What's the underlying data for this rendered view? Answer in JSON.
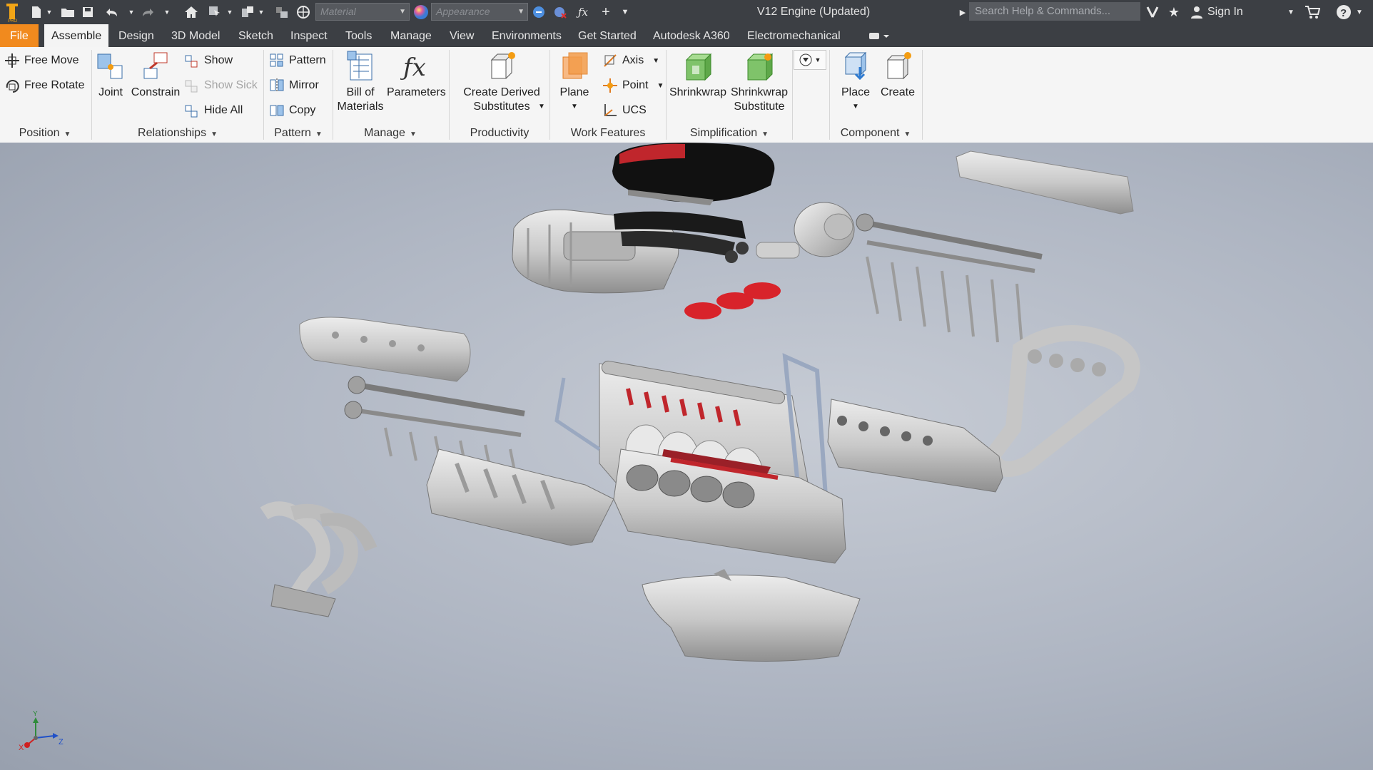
{
  "titlebar": {
    "material_placeholder": "Material",
    "appearance_placeholder": "Appearance",
    "document_title": "V12 Engine (Updated)",
    "search_placeholder": "Search Help & Commands...",
    "sign_in": "Sign In"
  },
  "tabs": [
    {
      "label": "File"
    },
    {
      "label": "Assemble"
    },
    {
      "label": "Design"
    },
    {
      "label": "3D Model"
    },
    {
      "label": "Sketch"
    },
    {
      "label": "Inspect"
    },
    {
      "label": "Tools"
    },
    {
      "label": "Manage"
    },
    {
      "label": "View"
    },
    {
      "label": "Environments"
    },
    {
      "label": "Get Started"
    },
    {
      "label": "Autodesk A360"
    },
    {
      "label": "Electromechanical"
    }
  ],
  "ribbon": {
    "position": {
      "free_move": "Free Move",
      "free_rotate": "Free Rotate",
      "group": "Position"
    },
    "relationships": {
      "joint": "Joint",
      "constrain": "Constrain",
      "show": "Show",
      "show_sick": "Show Sick",
      "hide_all": "Hide All",
      "group": "Relationships"
    },
    "pattern": {
      "pattern": "Pattern",
      "mirror": "Mirror",
      "copy": "Copy",
      "group": "Pattern"
    },
    "manage": {
      "bom_line1": "Bill of",
      "bom_line2": "Materials",
      "parameters": "Parameters",
      "group": "Manage"
    },
    "productivity": {
      "line1": "Create Derived",
      "line2": "Substitutes",
      "group": "Productivity"
    },
    "work_features": {
      "plane": "Plane",
      "axis": "Axis",
      "point": "Point",
      "ucs": "UCS",
      "group": "Work Features"
    },
    "simplification": {
      "shrinkwrap": "Shrinkwrap",
      "sub_line1": "Shrinkwrap",
      "sub_line2": "Substitute",
      "group": "Simplification"
    },
    "component": {
      "place": "Place",
      "create": "Create",
      "group": "Component"
    }
  },
  "axis_triad": {
    "x": "X",
    "y": "Y",
    "z": "Z"
  },
  "colors": {
    "chrome": "#3c3f44",
    "file_tab": "#f18a1e",
    "ribbon": "#f5f5f5",
    "part_gray": "#c9c9c9",
    "gasket_red": "#d8232a"
  }
}
